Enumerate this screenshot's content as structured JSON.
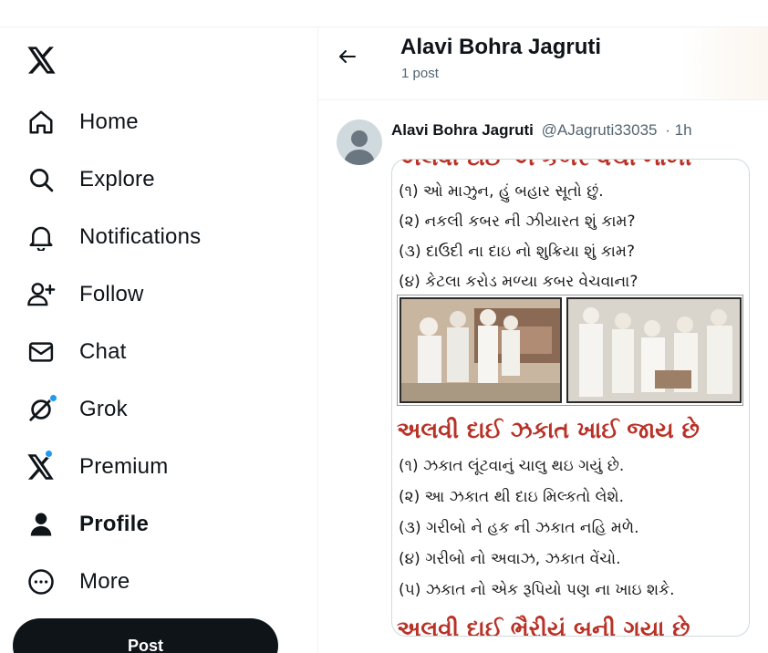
{
  "nav": {
    "logo_icon": "x-logo-icon",
    "items": [
      {
        "label": "Home",
        "icon": "home-icon"
      },
      {
        "label": "Explore",
        "icon": "search-icon"
      },
      {
        "label": "Notifications",
        "icon": "bell-icon"
      },
      {
        "label": "Follow",
        "icon": "add-person-icon"
      },
      {
        "label": "Chat",
        "icon": "mail-icon"
      },
      {
        "label": "Grok",
        "icon": "grok-icon"
      },
      {
        "label": "Premium",
        "icon": "x-premium-icon"
      },
      {
        "label": "Profile",
        "icon": "person-icon"
      },
      {
        "label": "More",
        "icon": "more-circle-icon"
      }
    ],
    "post_label": "Post"
  },
  "header": {
    "title": "Alavi Bohra Jagruti",
    "subtitle": "1 post"
  },
  "tweet": {
    "name": "Alavi Bohra Jagruti",
    "handle": "@AJagruti33035",
    "time": "· 1h",
    "image_text": {
      "lines_top": [
        "(૧) ઓ માઝુન, હું બહાર સૂતો છું.",
        "(૨) નકલી કબર ની ઝીયારત શું કામ?",
        "(૩) દાઉદી ના દાઇ નો શુક્રિયા શું કામ?",
        "(૪) કેટલા કરોડ મળ્યા કબર વેચવાના?"
      ],
      "heading": "અલવી દાઈ ઝકાત ખાઈ જાય છે",
      "lines_bottom": [
        "(૧) ઝકાત લૂંટવાનું ચાલુ થઇ ગયું છે.",
        "(૨) આ ઝકાત થી દાઇ મિલ્કતો લેશે.",
        "(૩) ગરીબો ને હક ની ઝકાત નહિ મળે.",
        "(૪) ગરીબો નો અવાઝ, ઝકાત વેંચો.",
        "(૫) ઝકાત નો એક રૂપિયો પણ ના ખાઇ શકે."
      ],
      "heading_bottom_partial": "અલવી દાઈ ભૈરીયું બની ગયા છે"
    }
  },
  "colors": {
    "accent": "#1d9bf0",
    "text": "#0f1419",
    "muted": "#536471",
    "heading_red": "#b83227"
  }
}
